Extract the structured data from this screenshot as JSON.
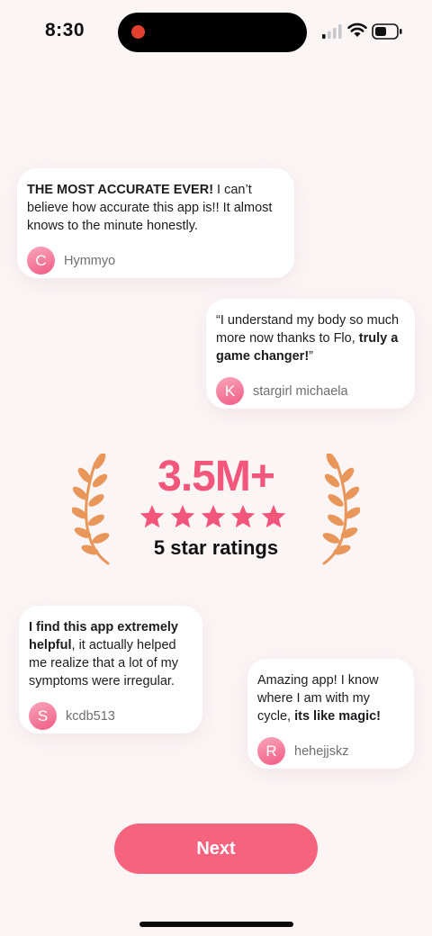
{
  "status_bar": {
    "time": "8:30",
    "icons": [
      "recording-indicator",
      "cellular-signal-icon",
      "wifi-icon",
      "battery-icon"
    ]
  },
  "reviews": [
    {
      "bold_text": "THE MOST ACCURATE EVER!",
      "text": " I can’t believe how accurate this app is!! It almost knows to the minute honestly.",
      "avatar_initial": "C",
      "author": "Hymmyo"
    },
    {
      "text": "“I understand my body so much more now thanks to Flo, ",
      "bold_text": "truly a game changer!",
      "text_end": "”",
      "avatar_initial": "K",
      "author": "stargirl michaela"
    },
    {
      "bold_text": "I find this app extremely helpful",
      "text": ", it actually helped me realize that a lot of my symptoms were irregular.",
      "avatar_initial": "S",
      "author": "kcdb513"
    },
    {
      "text": "Amazing app! I know where I am with my cycle, ",
      "bold_text": "its like magic!",
      "avatar_initial": "R",
      "author": "hehejjskz"
    }
  ],
  "ratings": {
    "count": "3.5M+",
    "stars": 5,
    "label": "5 star ratings"
  },
  "next_button": {
    "label": "Next"
  },
  "colors": {
    "background": "#fbf5f6",
    "accent_pink": "#f2567a",
    "button": "#f5637f",
    "laurel": "#e8965a"
  }
}
